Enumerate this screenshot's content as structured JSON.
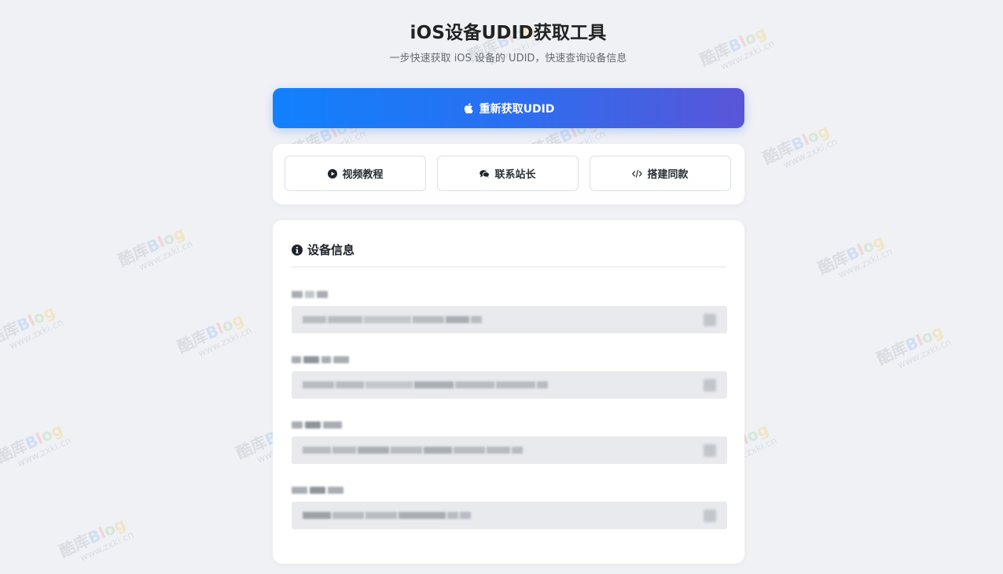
{
  "header": {
    "title": "iOS设备UDID获取工具",
    "subtitle": "一步快速获取 iOS 设备的 UDID，快速查询设备信息"
  },
  "primary_button": {
    "label": "重新获取UDID",
    "icon": "apple-icon"
  },
  "actions": [
    {
      "label": "视频教程",
      "icon": "play-circle-icon"
    },
    {
      "label": "联系站长",
      "icon": "chat-bubbles-icon"
    },
    {
      "label": "搭建同款",
      "icon": "code-icon"
    }
  ],
  "device_info": {
    "heading": "设备信息",
    "heading_icon": "info-circle-icon",
    "fields_note": "field labels and values are pixelated/blurred in the screenshot",
    "fields": [
      {
        "label": "",
        "value": ""
      },
      {
        "label": "",
        "value": ""
      },
      {
        "label": "",
        "value": ""
      },
      {
        "label": "",
        "value": ""
      }
    ]
  },
  "watermark": {
    "brand": "酷库Blog",
    "url": "www.zxki.cn"
  },
  "colors": {
    "background": "#eff1f5",
    "primary_gradient_start": "#1181fd",
    "primary_gradient_end": "#5a55d8",
    "card": "#ffffff",
    "field_bg": "#e8eaed"
  }
}
